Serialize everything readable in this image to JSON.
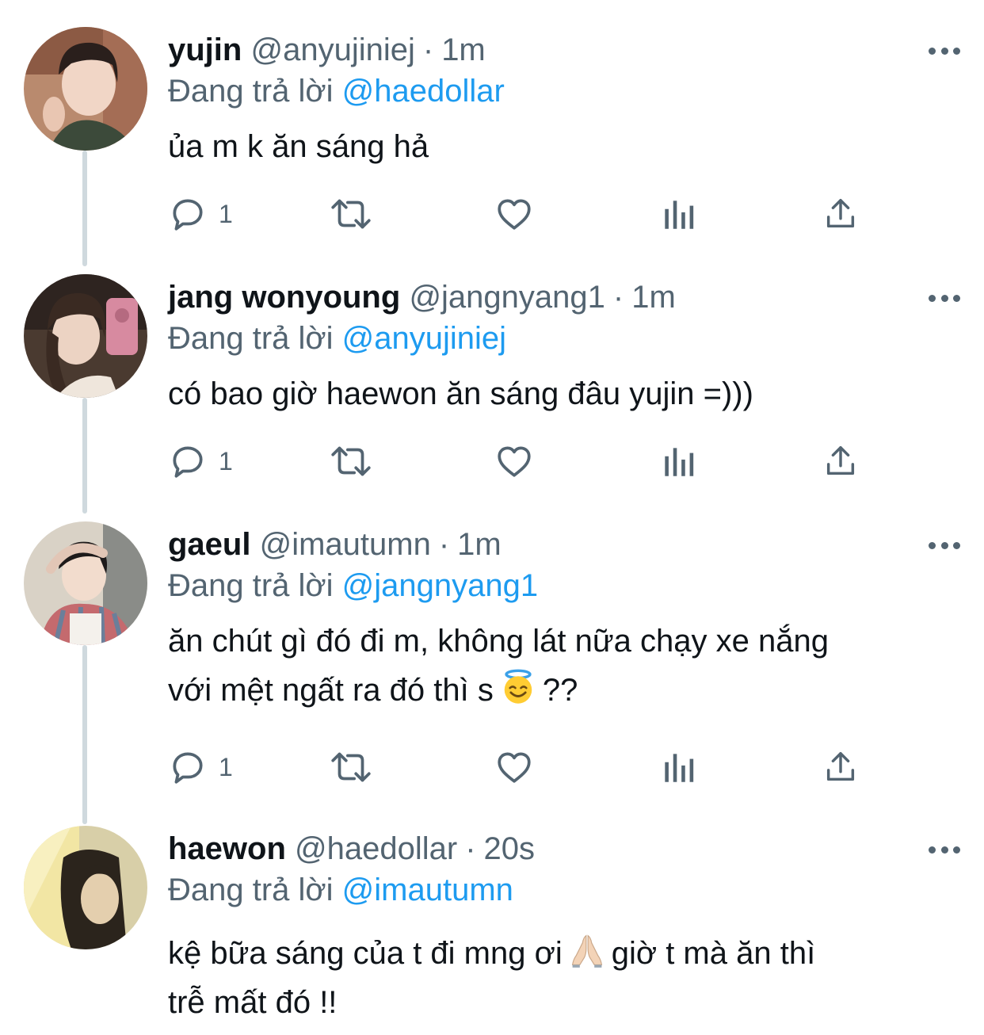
{
  "labels": {
    "replying_prefix": "Đang trả lời"
  },
  "tweets": [
    {
      "display_name": "yujin",
      "handle": "@anyujiniej",
      "separator": "·",
      "time": "1m",
      "replying_to": "@haedollar",
      "lines": [
        "ủa m k ăn sáng hả",
        ""
      ],
      "reply_count": "1"
    },
    {
      "display_name": "jang wonyoung",
      "handle": "@jangnyang1",
      "separator": "·",
      "time": "1m",
      "replying_to": "@anyujiniej",
      "lines": [
        "có bao giờ haewon ăn sáng đâu yujin =)))",
        ""
      ],
      "reply_count": "1"
    },
    {
      "display_name": "gaeul",
      "handle": "@imautumn",
      "separator": "·",
      "time": "1m",
      "replying_to": "@jangnyang1",
      "lines": [
        "ăn chút gì đó đi m, không lát nữa chạy xe nắng",
        "với mệt ngất ra đó thì s",
        "??"
      ],
      "reply_count": "1"
    },
    {
      "display_name": "haewon",
      "handle": "@haedollar",
      "separator": "·",
      "time": "20s",
      "replying_to": "@imautumn",
      "lines": [
        "kệ bữa sáng của t đi mng ơi",
        "giờ t mà ăn thì",
        "trễ mất đó !!"
      ],
      "reply_count": ""
    }
  ],
  "icons": {
    "reply": "speech-bubble-icon",
    "retweet": "retweet-arrows-icon",
    "like": "heart-icon",
    "views": "bar-chart-icon",
    "share": "upload-arrow-icon",
    "more": "ellipsis-icon",
    "emoji_1": "smiling-face-with-halo-emoji",
    "emoji_2": "folded-hands-emoji"
  },
  "colors": {
    "link": "#1d9bf0",
    "secondary_text": "#536471",
    "thread_line": "#cfd9de"
  }
}
